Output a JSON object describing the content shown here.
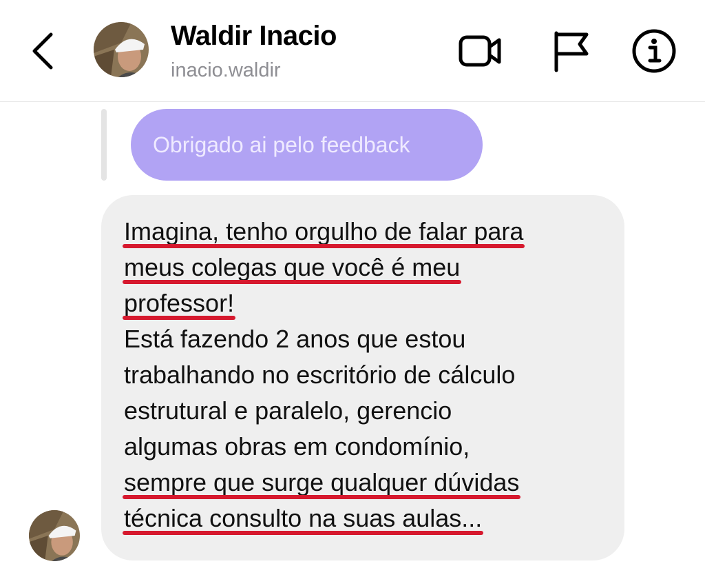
{
  "header": {
    "name": "Waldir Inacio",
    "handle": "inacio.waldir",
    "icons": [
      "back-chevron-icon",
      "video-call-icon",
      "flag-icon",
      "info-icon"
    ]
  },
  "reply_message": {
    "text": "Obrigado ai pelo feedback",
    "bubble_color": "#b1a3f4"
  },
  "incoming_message": {
    "lines": [
      "Imagina, tenho orgulho de falar para",
      "meus colegas que você é meu",
      "professor!",
      "Está fazendo 2 anos que estou",
      "trabalhando no escritório de cálculo",
      "estrutural e paralelo, gerencio",
      "algumas obras em condomínio,",
      "sempre que surge qualquer dúvidas",
      "técnica consulto na suas aulas..."
    ],
    "underlined_lines": [
      0,
      1,
      2,
      7,
      8
    ],
    "underline_color": "#d6192e",
    "bubble_color": "#efefef"
  }
}
